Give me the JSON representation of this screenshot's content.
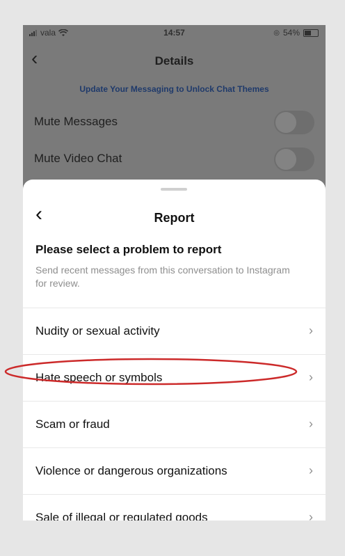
{
  "status": {
    "carrier": "vala",
    "time": "14:57",
    "battery": "54%"
  },
  "background": {
    "title": "Details",
    "banner": "Update Your Messaging to Unlock Chat Themes",
    "rows": [
      {
        "label": "Mute Messages"
      },
      {
        "label": "Mute Video Chat"
      }
    ]
  },
  "sheet": {
    "title": "Report",
    "prompt": "Please select a problem to report",
    "description": "Send recent messages from this conversation to Instagram for review.",
    "items": [
      {
        "label": "Nudity or sexual activity"
      },
      {
        "label": "Hate speech or symbols"
      },
      {
        "label": "Scam or fraud"
      },
      {
        "label": "Violence or dangerous organizations"
      },
      {
        "label": "Sale of illegal or regulated goods"
      }
    ]
  },
  "colors": {
    "highlight_circle": "#cc2a2a",
    "dim_overlay": "#7a7a7a"
  }
}
